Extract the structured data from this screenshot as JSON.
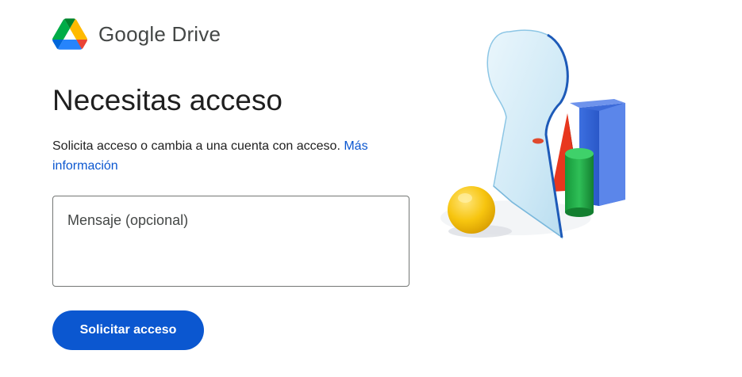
{
  "brand": {
    "logo_icon": "google-drive-logo-icon",
    "name": "Google Drive"
  },
  "main": {
    "title": "Necesitas acceso",
    "description": "Solicita acceso o cambia a una cuenta con acceso.",
    "learn_more_link": "Más información",
    "message_placeholder": "Mensaje (opcional)",
    "message_value": "",
    "request_button": "Solicitar acceso"
  },
  "illustration": {
    "icon": "keyhole-with-shapes-illustration"
  },
  "colors": {
    "accent": "#0b57d0",
    "text": "#1f1f1f",
    "secondary_text": "#444746",
    "border": "#747775"
  }
}
